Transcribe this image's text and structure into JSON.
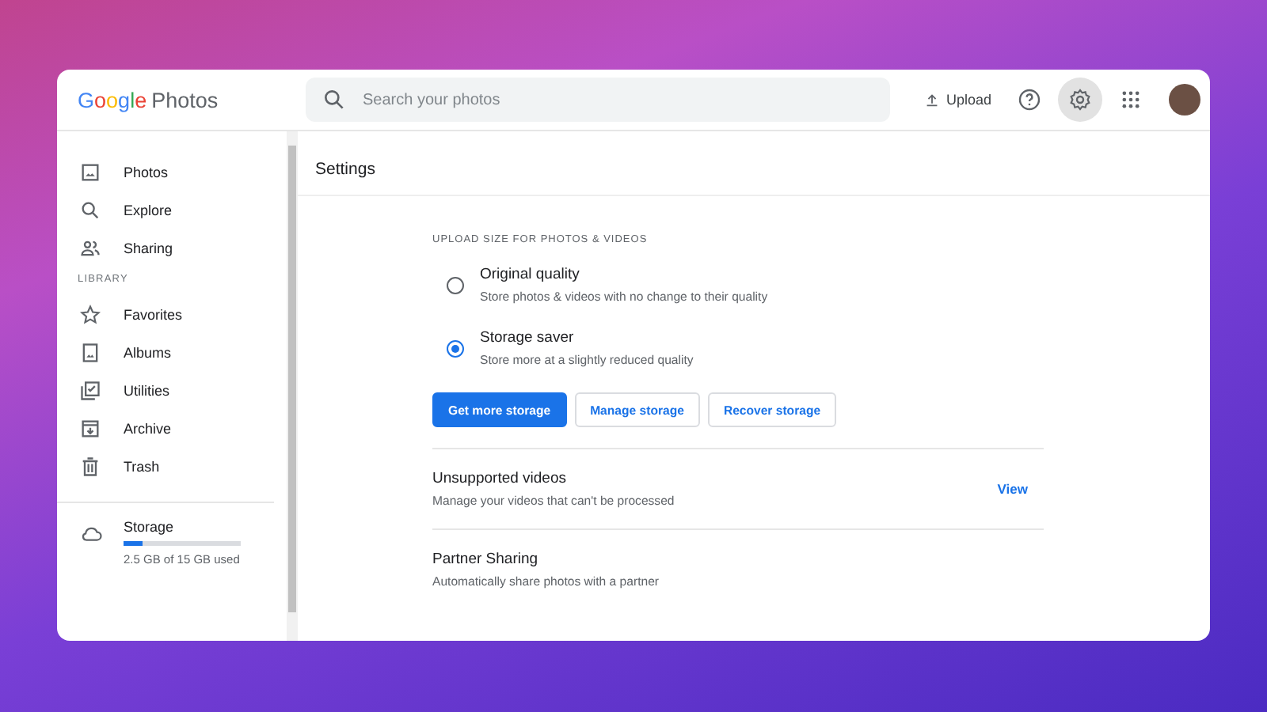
{
  "header": {
    "logo": {
      "brand": "Google",
      "product": "Photos"
    },
    "search": {
      "placeholder": "Search your photos"
    },
    "upload_label": "Upload",
    "settings_selected": true
  },
  "sidebar": {
    "items": [
      {
        "kind": "photos",
        "label": "Photos",
        "selected": false
      },
      {
        "kind": "explore",
        "label": "Explore",
        "selected": false
      },
      {
        "kind": "sharing",
        "label": "Sharing",
        "selected": false
      }
    ],
    "library_heading": "LIBRARY",
    "library_items": [
      {
        "kind": "star",
        "label": "Favorites",
        "selected": false
      },
      {
        "kind": "album",
        "label": "Albums",
        "selected": false
      },
      {
        "kind": "utilities",
        "label": "Utilities",
        "selected": false
      },
      {
        "kind": "archive",
        "label": "Archive",
        "selected": false
      },
      {
        "kind": "trash",
        "label": "Trash",
        "selected": false
      }
    ],
    "storage": {
      "label": "Storage",
      "level": 0.16,
      "usage": "2.5 GB of 15 GB used"
    }
  },
  "settings": {
    "title": "Settings",
    "section_heading": "UPLOAD SIZE FOR PHOTOS & VIDEOS",
    "options": [
      {
        "title": "Original quality",
        "description": "Store photos & videos with no change to their quality",
        "selected": false
      },
      {
        "title": "Storage saver",
        "description": "Store more at a slightly reduced quality",
        "selected": true
      }
    ],
    "buttons": [
      {
        "label": "Get more storage",
        "kind": "primary"
      },
      {
        "label": "Manage storage",
        "kind": "outlined"
      },
      {
        "label": "Recover storage",
        "kind": "outlined"
      }
    ],
    "rows": [
      {
        "title": "Unsupported videos",
        "description": "Manage your videos that can't be processed",
        "action": "View"
      },
      {
        "title": "Partner Sharing",
        "description": "Automatically share photos with a partner"
      }
    ]
  }
}
